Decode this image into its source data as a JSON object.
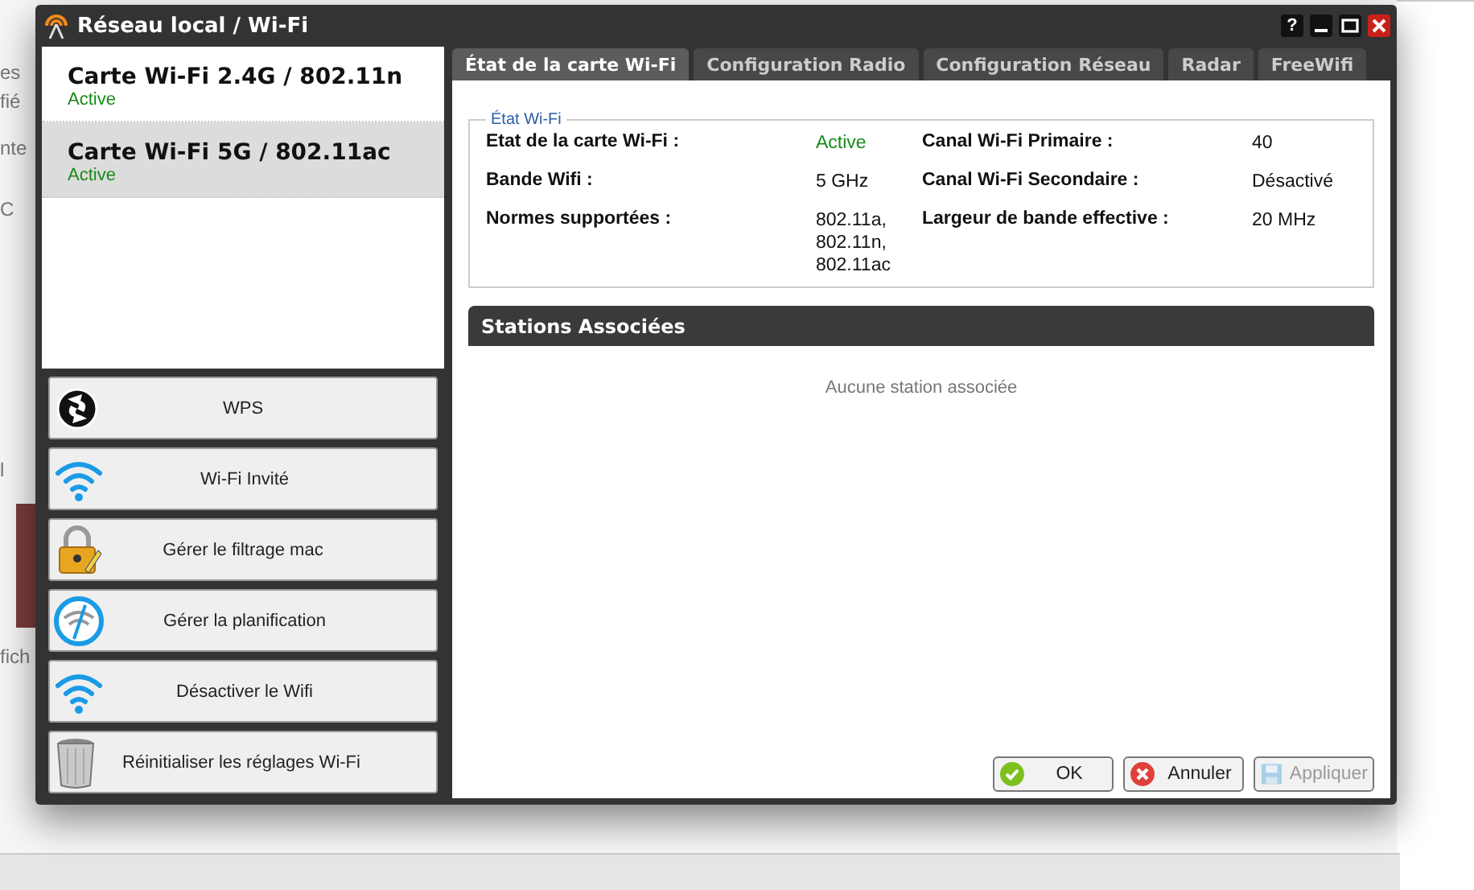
{
  "background": {
    "fragments": [
      "es",
      "fié",
      "nte",
      "C",
      "l",
      "fich"
    ]
  },
  "window": {
    "title": "Réseau local / Wi-Fi",
    "help": "?"
  },
  "cards": [
    {
      "name": "Carte Wi-Fi 2.4G / 802.11n",
      "status": "Active",
      "selected": false
    },
    {
      "name": "Carte Wi-Fi 5G / 802.11ac",
      "status": "Active",
      "selected": true
    }
  ],
  "actions": [
    {
      "kind": "wps",
      "label": "WPS"
    },
    {
      "kind": "wifi",
      "label": "Wi-Fi Invité"
    },
    {
      "kind": "lock",
      "label": "Gérer le filtrage mac"
    },
    {
      "kind": "clock",
      "label": "Gérer la planification"
    },
    {
      "kind": "wifi",
      "label": "Désactiver le Wifi"
    },
    {
      "kind": "trash",
      "label": "Réinitialiser les réglages Wi-Fi"
    }
  ],
  "tabs": [
    {
      "label": "État de la carte Wi-Fi",
      "selected": true
    },
    {
      "label": "Configuration Radio",
      "selected": false
    },
    {
      "label": "Configuration Réseau",
      "selected": false
    },
    {
      "label": "Radar",
      "selected": false
    },
    {
      "label": "FreeWifi",
      "selected": false
    }
  ],
  "status_group": {
    "legend": "État Wi-Fi",
    "rows": [
      {
        "label": "Etat de la carte Wi-Fi :",
        "value": "Active",
        "ok": true,
        "label_2": "Canal Wi-Fi Primaire :",
        "value_2": "40"
      },
      {
        "label": "Bande Wifi :",
        "value": "5 GHz",
        "ok": false,
        "label_2": "Canal Wi-Fi Secondaire :",
        "value_2": "Désactivé"
      },
      {
        "label": "Normes supportées :",
        "value": "802.11a, 802.11n, 802.11ac",
        "ok": false,
        "label_2": "Largeur de bande effective :",
        "value_2": "20 MHz"
      }
    ]
  },
  "stations": {
    "title": "Stations Associées",
    "empty": "Aucune station associée"
  },
  "buttons": [
    {
      "kind": "ok",
      "label": "OK",
      "disabled": false
    },
    {
      "kind": "cancel",
      "label": "Annuler",
      "disabled": false
    },
    {
      "kind": "apply",
      "label": "Appliquer",
      "disabled": true
    }
  ]
}
